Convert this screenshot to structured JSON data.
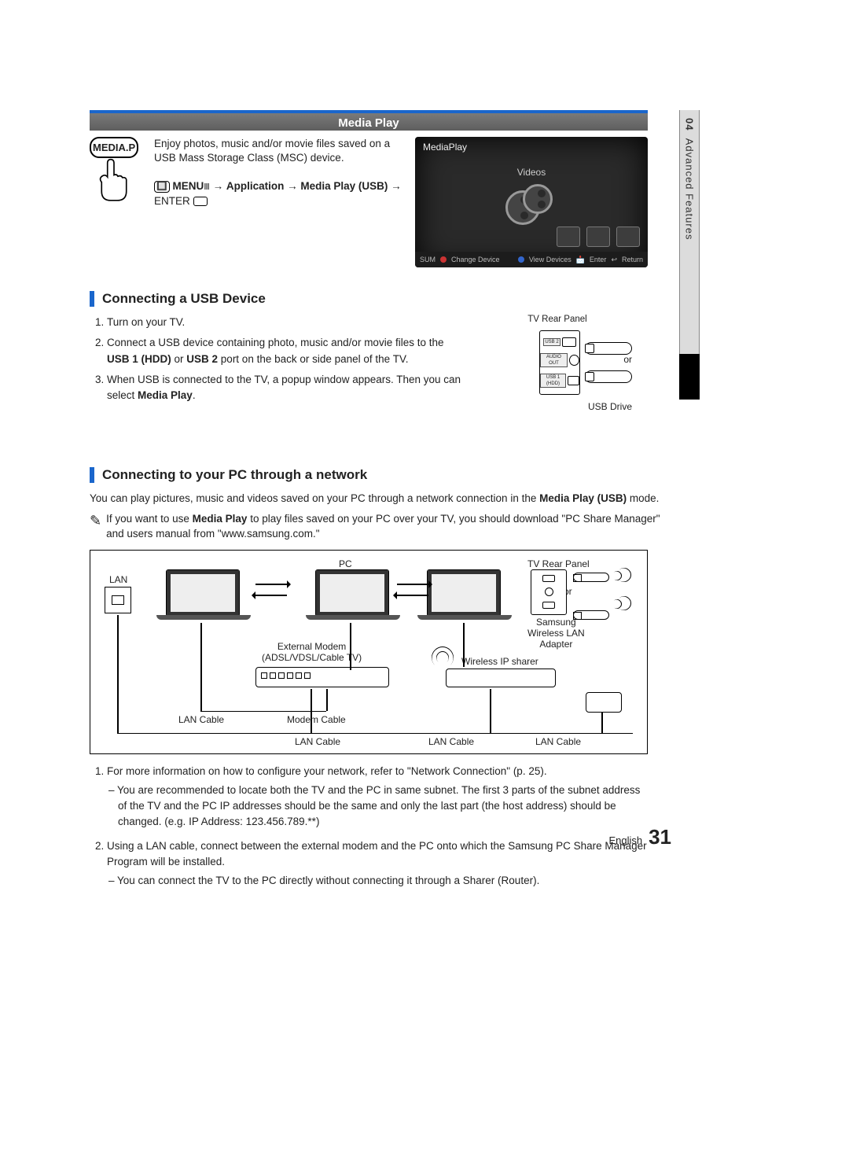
{
  "side_tab": {
    "chapter": "04",
    "label": "Advanced Features"
  },
  "titlebar": "Media Play",
  "mediap": {
    "chip": "MEDIA.P",
    "desc": "Enjoy photos, music and/or movie files saved on a USB Mass Storage Class (MSC) device.",
    "kbd": "O",
    "menu": "MENU",
    "arrow": "→",
    "application": "Application",
    "mediaplay": "Media Play (USB)",
    "enter": "ENTER",
    "enter_glyph": "E"
  },
  "preview": {
    "app": "MediaPlay",
    "tab": "Videos",
    "footer": {
      "sum": "SUM",
      "a": "Change Device",
      "d": "View Devices",
      "enter": "Enter",
      "return": "Return"
    }
  },
  "usb_section": {
    "heading": "Connecting a USB Device",
    "rear_label": "TV Rear Panel",
    "usb2": "USB 2",
    "audio": "AUDIO OUT",
    "usb1": "USB 1 (HDD)",
    "or": "or",
    "usb_drive": "USB Drive",
    "steps": [
      "Turn on your TV.",
      "Connect a USB device containing photo, music and/or movie files to the <b>USB 1 (HDD)</b> or <b>USB 2</b> port on the back or side panel of the TV.",
      "When USB is connected to the TV, a popup window appears. Then you can select <b>Media Play</b>."
    ]
  },
  "net_section": {
    "heading": "Connecting to your PC through a network",
    "intro": "You can play pictures, music and videos saved on your PC through a network connection in the <b>Media Play (USB)</b> mode.",
    "note": "If you want to use <b>Media Play</b> to play files saved on your PC over your TV, you should download \"PC Share Manager\" and users manual from \"www.samsung.com.\"",
    "diagram": {
      "lan": "LAN",
      "pc": "PC",
      "rear": "TV Rear Panel",
      "or": "or",
      "adapter": "Samsung\nWireless LAN\nAdapter",
      "modem": "External Modem\n(ADSL/VDSL/Cable TV)",
      "sharer": "Wireless IP sharer",
      "lan_cable": "LAN Cable",
      "modem_cable": "Modem Cable"
    },
    "steps": [
      {
        "text": "For more information on how to configure your network, refer to \"Network Connection\" (p. 25).",
        "subs": [
          "You are recommended to locate both the TV and the PC in same subnet. The first 3 parts of the subnet address of the TV and the PC IP addresses should be the same and only the last part (the host address) should be changed. (e.g. IP Address: 123.456.789.**)"
        ]
      },
      {
        "text": "Using a LAN cable, connect between the external modem and the PC onto which the Samsung PC Share Manager Program will be installed.",
        "subs": [
          "You can connect the TV to the PC directly without connecting it through a Sharer (Router)."
        ]
      }
    ]
  },
  "footer": {
    "lang": "English",
    "page": "31"
  }
}
